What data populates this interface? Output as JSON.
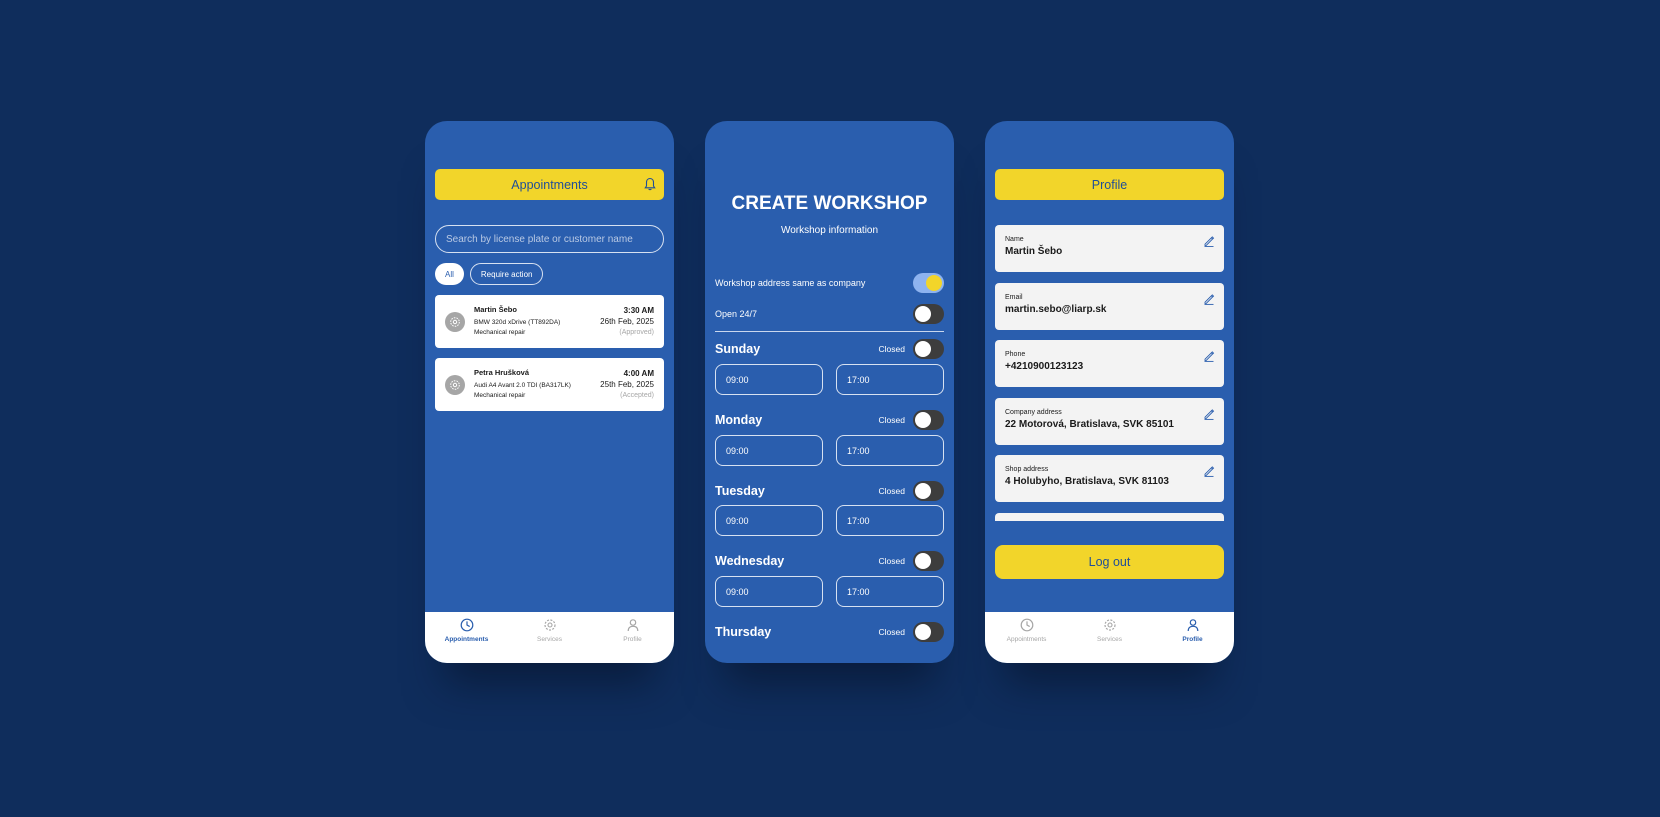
{
  "appointments_screen": {
    "header_title": "Appointments",
    "search_placeholder": "Search by license plate or customer name",
    "filters": [
      "All",
      "Require action"
    ],
    "appointments": [
      {
        "name": "Martin Šebo",
        "vehicle": "BMW 320d xDrive (TT892DA)",
        "service": "Mechanical repair",
        "time": "3:30 AM",
        "date": "26th Feb, 2025",
        "status": "(Approved)"
      },
      {
        "name": "Petra Hrušková",
        "vehicle": "Audi A4 Avant 2.0 TDI (BA317LK)",
        "service": "Mechanical repair",
        "time": "4:00 AM",
        "date": "25th Feb, 2025",
        "status": "(Accepted)"
      }
    ],
    "nav": [
      "Appointments",
      "Services",
      "Profile"
    ],
    "active_nav": "Appointments"
  },
  "workshop_screen": {
    "title": "CREATE WORKSHOP",
    "subtitle": "Workshop information",
    "address_same_label": "Workshop address same as company",
    "address_same_on": true,
    "open_247_label": "Open 24/7",
    "open_247_on": false,
    "closed_label": "Closed",
    "days": [
      {
        "name": "Sunday",
        "open": "09:00",
        "close": "17:00"
      },
      {
        "name": "Monday",
        "open": "09:00",
        "close": "17:00"
      },
      {
        "name": "Tuesday",
        "open": "09:00",
        "close": "17:00"
      },
      {
        "name": "Wednesday",
        "open": "09:00",
        "close": "17:00"
      },
      {
        "name": "Thursday"
      }
    ]
  },
  "profile_screen": {
    "header_title": "Profile",
    "fields": [
      {
        "label": "Name",
        "value": "Martin Šebo"
      },
      {
        "label": "Email",
        "value": "martin.sebo@liarp.sk"
      },
      {
        "label": "Phone",
        "value": "+4210900123123"
      },
      {
        "label": "Company address",
        "value": "22 Motorová, Bratislava, SVK 85101"
      },
      {
        "label": "Shop address",
        "value": "4 Holubyho, Bratislava, SVK 81103"
      }
    ],
    "logout_label": "Log out",
    "nav": [
      "Appointments",
      "Services",
      "Profile"
    ],
    "active_nav": "Profile"
  },
  "colors": {
    "background": "#0f2d5c",
    "screen_blue": "#2a5eae",
    "accent_yellow": "#f2d52a",
    "inactive_gray": "#a6a6a6"
  }
}
